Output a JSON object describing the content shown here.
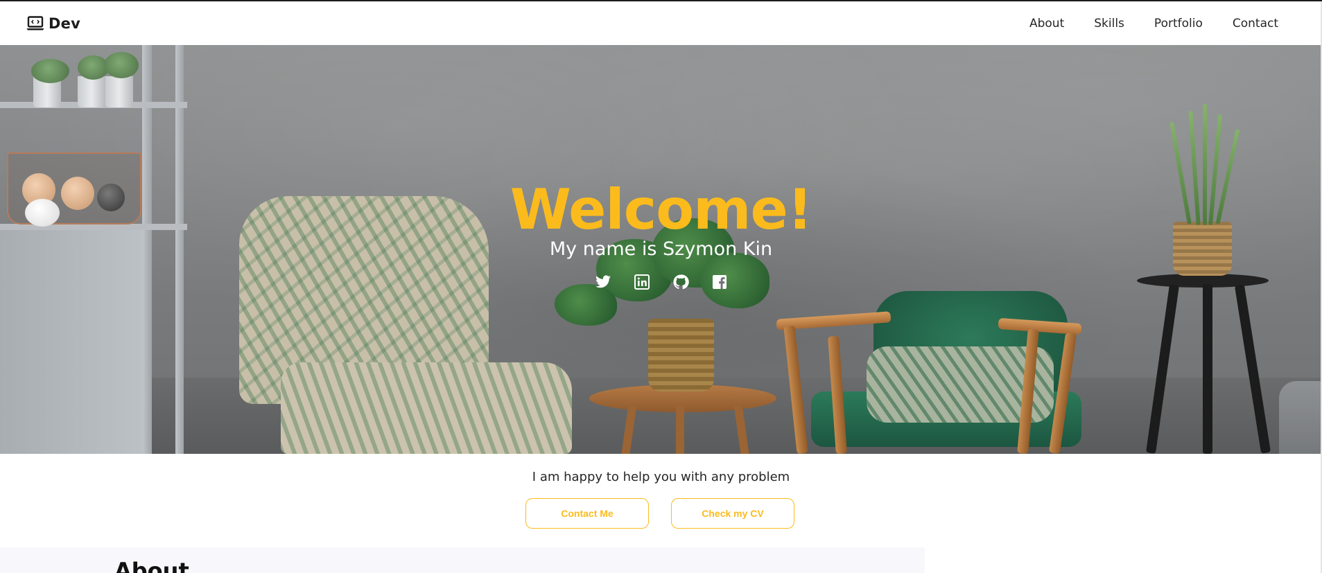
{
  "navbar": {
    "brand": "Dev",
    "brand_icon": "laptop-code-icon",
    "links": [
      {
        "label": "About"
      },
      {
        "label": "Skills"
      },
      {
        "label": "Portfolio"
      },
      {
        "label": "Contact"
      }
    ]
  },
  "hero": {
    "title": "Welcome!",
    "subtitle": "My name is Szymon Kin",
    "social_icons": [
      "twitter-icon",
      "linkedin-icon",
      "github-icon",
      "facebook-icon"
    ]
  },
  "intro": {
    "tagline": "I am happy to help you with any problem",
    "buttons": [
      {
        "label": "Contact Me"
      },
      {
        "label": "Check my CV"
      }
    ]
  },
  "about": {
    "heading": "About"
  },
  "colors": {
    "accent": "#fbbb1c",
    "text_dark": "#262626",
    "subtitle": "#ffffff",
    "about_background": "#f8f8fc"
  }
}
